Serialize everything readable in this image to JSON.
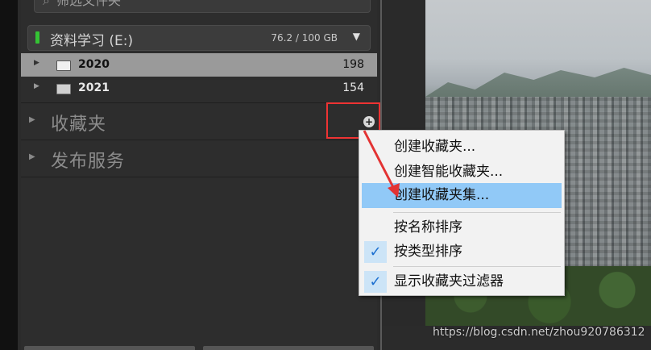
{
  "filter": {
    "icon": "search-icon",
    "label": "筛选文件夹"
  },
  "volume": {
    "name": "资料学习 (E:)",
    "usage": "76.2 / 100 GB",
    "indicator_color": "#34c334"
  },
  "folders": [
    {
      "name": "2020",
      "count": "198"
    },
    {
      "name": "2021",
      "count": "154"
    }
  ],
  "sections": {
    "collections": "收藏夹",
    "publish": "发布服务"
  },
  "plus_button": "+",
  "context_menu": {
    "items": [
      {
        "label": "创建收藏夹..."
      },
      {
        "label": "创建智能收藏夹..."
      },
      {
        "label": "创建收藏夹集..."
      },
      {
        "label": "按名称排序"
      },
      {
        "label": "按类型排序"
      },
      {
        "label": "显示收藏夹过滤器"
      }
    ],
    "check": "✓"
  },
  "watermark": "https://blog.csdn.net/zhou920786312",
  "colors": {
    "highlight": "#e33333",
    "menu_hover": "#91c9f7",
    "arrow": "#e33333"
  }
}
